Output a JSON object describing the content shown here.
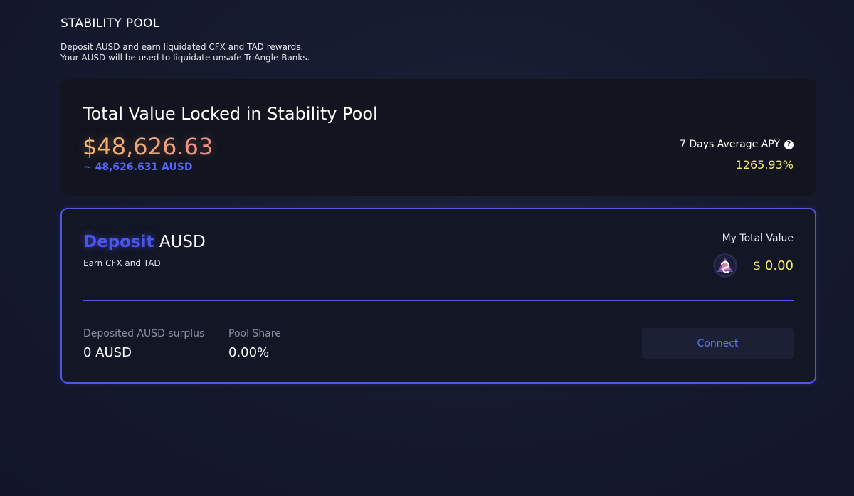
{
  "header": {
    "title": "STABILITY POOL",
    "description_line1": "Deposit AUSD and earn liquidated CFX and TAD rewards.",
    "description_line2": "Your AUSD will be used to liquidate unsafe TriAngle Banks."
  },
  "tvl": {
    "title": "Total Value Locked in Stability Pool",
    "usd_value": "$48,626.63",
    "ausd_value": "~ 48,626.631 AUSD",
    "apy_label": "7 Days Average APY",
    "apy_value": "1265.93%"
  },
  "deposit": {
    "title_highlight": "Deposit",
    "title_token": "AUSD",
    "subtitle": "Earn CFX and TAD",
    "total_label": "My Total Value",
    "total_value": "$ 0.00",
    "deposited_label": "Deposited AUSD surplus",
    "deposited_value": "0 AUSD",
    "pool_share_label": "Pool Share",
    "pool_share_value": "0.00%",
    "connect_label": "Connect"
  },
  "colors": {
    "accent": "#4d57e0",
    "apy": "#f4ec6a",
    "tvl_gradient_start": "#f2be6a",
    "tvl_gradient_end": "#ee8e8e",
    "background": "#161a2d"
  },
  "icons": {
    "help": "question-circle-icon",
    "logo": "triangle-logo-icon"
  }
}
